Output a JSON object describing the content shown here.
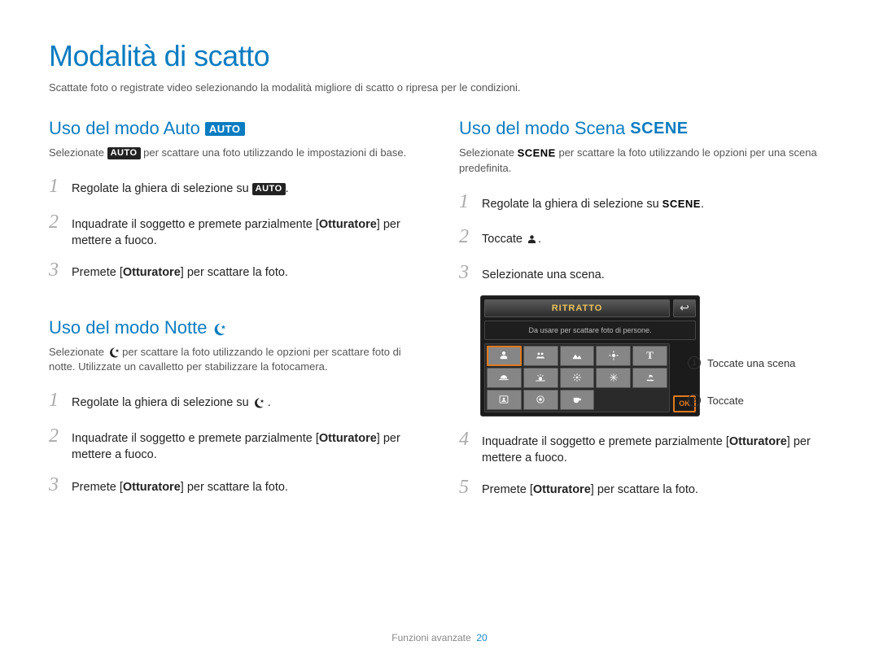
{
  "page_title": "Modalità di scatto",
  "page_subtitle": "Scattate foto o registrate video selezionando la modalità migliore di scatto o ripresa per le condizioni.",
  "auto": {
    "heading": "Uso del modo Auto",
    "badge": "AUTO",
    "desc_pre": "Selezionate ",
    "desc_post": " per scattare una foto utilizzando le impostazioni di base.",
    "steps": [
      {
        "pre": "Regolate la ghiera di selezione su ",
        "badge": "AUTO",
        "post": "."
      },
      {
        "text": "Inquadrate il soggetto e premete parzialmente [",
        "bold": "Otturatore",
        "post": "] per mettere a fuoco."
      },
      {
        "text": "Premete [",
        "bold": "Otturatore",
        "post": "] per scattare la foto."
      }
    ]
  },
  "notte": {
    "heading": "Uso del modo Notte",
    "desc": "Selezionate        per scattare la foto utilizzando le opzioni per scattare foto di notte. Utilizzate un cavalletto per stabilizzare la fotocamera.",
    "steps": [
      {
        "pre": "Regolate la ghiera di selezione su ",
        "post": " ."
      },
      {
        "text": "Inquadrate il soggetto e premete parzialmente [",
        "bold": "Otturatore",
        "post": "] per mettere a fuoco."
      },
      {
        "text": "Premete [",
        "bold": "Otturatore",
        "post": "] per scattare la foto."
      }
    ]
  },
  "scena": {
    "heading": "Uso del modo Scena",
    "badge": "SCENE",
    "desc_pre": "Selezionate ",
    "desc_post": " per scattare la foto utilizzando le opzioni per una scena predefinita.",
    "steps_a": [
      {
        "pre": "Regolate la ghiera di selezione su ",
        "badge": "SCENE",
        "post": "."
      },
      {
        "text": "Toccate ",
        "icon": true,
        "post": "."
      },
      {
        "text": "Selezionate una scena."
      }
    ],
    "lcd": {
      "title": "RITRATTO",
      "desc": "Da usare per scattare foto di persone.",
      "ok": "OK"
    },
    "steps_b": [
      {
        "text": "Inquadrate il soggetto e premete parzialmente [",
        "bold": "Otturatore",
        "post": "] per mettere a fuoco."
      },
      {
        "text": "Premete [",
        "bold": "Otturatore",
        "post": "] per scattare la foto."
      }
    ]
  },
  "callouts": {
    "c1": "Toccate una scena",
    "c2": "Toccate"
  },
  "footer": {
    "label": "Funzioni avanzate",
    "page": "20"
  }
}
